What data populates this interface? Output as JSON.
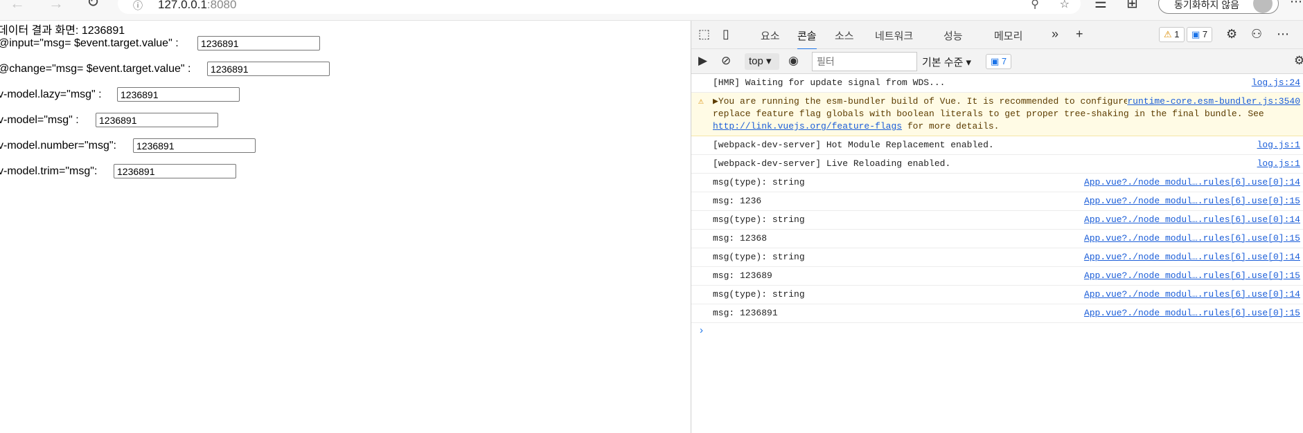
{
  "browser": {
    "url_host": "127.0.0.1",
    "url_port": ":8080",
    "sync_label": "동기화하지 않음"
  },
  "page": {
    "result_label": "데이터 결과 화면: 1236891",
    "rows": [
      {
        "label": "@input=\"msg= $event.target.value\" :",
        "value": "1236891"
      },
      {
        "label": "@change=\"msg= $event.target.value\" :",
        "value": "1236891"
      },
      {
        "label": "v-model.lazy=\"msg\" :",
        "value": "1236891"
      },
      {
        "label": "v-model=\"msg\" :",
        "value": "1236891"
      },
      {
        "label": "v-model.number=\"msg\":",
        "value": "1236891"
      },
      {
        "label": "v-model.trim=\"msg\":",
        "value": "1236891"
      }
    ]
  },
  "devtools": {
    "tabs": [
      "요소",
      "콘솔",
      "소스",
      "네트워크",
      "성능",
      "메모리"
    ],
    "active_tab": "콘솔",
    "warning_count": "1",
    "message_count": "7",
    "context": "top",
    "filter_placeholder": "필터",
    "levels_label": "기본 수준",
    "toolbar_message_count": "7",
    "logs": [
      {
        "text": "[HMR] Waiting for update signal from WDS...",
        "source": "log.js:24"
      },
      {
        "text": "[webpack-dev-server] Hot Module Replacement enabled.",
        "source": "log.js:1"
      },
      {
        "text": "[webpack-dev-server] Live Reloading enabled.",
        "source": "log.js:1"
      },
      {
        "text": "msg(type): string",
        "source": "App.vue?./node_modul….rules[6].use[0]:14"
      },
      {
        "text": "msg: 1236",
        "source": "App.vue?./node_modul….rules[6].use[0]:15"
      },
      {
        "text": "msg(type): string",
        "source": "App.vue?./node_modul….rules[6].use[0]:14"
      },
      {
        "text": "msg: 12368",
        "source": "App.vue?./node_modul….rules[6].use[0]:15"
      },
      {
        "text": "msg(type): string",
        "source": "App.vue?./node_modul….rules[6].use[0]:14"
      },
      {
        "text": "msg: 123689",
        "source": "App.vue?./node_modul….rules[6].use[0]:15"
      },
      {
        "text": "msg(type): string",
        "source": "App.vue?./node_modul….rules[6].use[0]:14"
      },
      {
        "text": "msg: 1236891",
        "source": "App.vue?./node_modul….rules[6].use[0]:15"
      }
    ],
    "warning": {
      "text_1": "You are running the esm-bundler build of Vue. It is recommended to configure your bundler to explicitly replace feature flag globals with boolean literals to get proper tree-shaking in the final bundle. See ",
      "link": "http://link.vuejs.org/feature-flags",
      "text_2": " for more details.",
      "source": "runtime-core.esm-bundler.js:3540"
    }
  }
}
